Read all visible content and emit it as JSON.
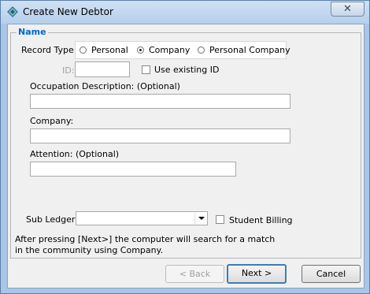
{
  "window": {
    "title": "Create New Debtor",
    "close_symbol": "✕"
  },
  "group": {
    "legend": "Name"
  },
  "record_type": {
    "label": "Record Type:",
    "options": [
      {
        "label": "Personal",
        "checked": false
      },
      {
        "label": "Company",
        "checked": true
      },
      {
        "label": "Personal Company",
        "checked": false
      }
    ]
  },
  "id_field": {
    "label": "ID:",
    "value": "",
    "enabled": false
  },
  "use_existing_id": {
    "label": "Use existing ID",
    "checked": false
  },
  "occupation": {
    "label": "Occupation Description: (Optional)",
    "value": ""
  },
  "company": {
    "label": "Company:",
    "value": ""
  },
  "attention": {
    "label": "Attention:  (Optional)",
    "value": ""
  },
  "sub_ledger": {
    "label": "Sub Ledger:",
    "value": ""
  },
  "student_billing": {
    "label": "Student Billing",
    "checked": false
  },
  "info_text": "After pressing [Next>] the computer will search for a match in the community using Company.",
  "buttons": {
    "back": "< Back",
    "next": "Next >",
    "cancel": "Cancel"
  },
  "icons": {
    "app": "diamond-app-icon",
    "close": "close-icon",
    "dropdown": "chevron-down-icon"
  },
  "colors": {
    "title_bar": "#b6cfec",
    "legend": "#0066cc",
    "client": "#f0f0f0"
  }
}
